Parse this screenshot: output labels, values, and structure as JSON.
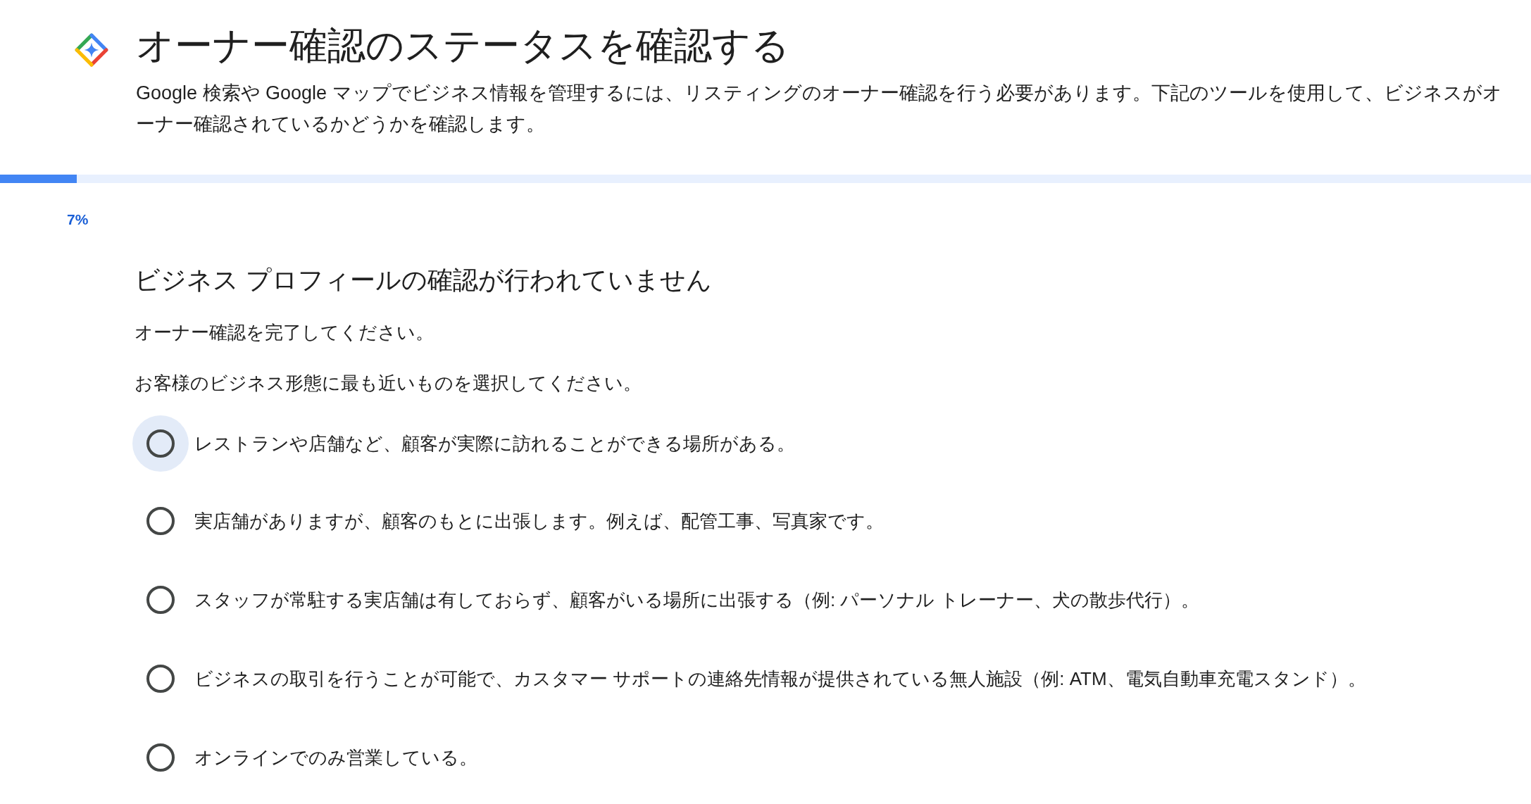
{
  "header": {
    "title": "オーナー確認のステータスを確認する",
    "description": "Google 検索や Google マップでビジネス情報を管理するには、リスティングのオーナー確認を行う必要があります。下記のツールを使用して、ビジネスがオーナー確認されているかどうかを確認します。"
  },
  "progress": {
    "level": 0.05,
    "reading": "7%"
  },
  "section": {
    "heading": "ビジネス プロフィールの確認が行われていません",
    "instruction": "オーナー確認を完了してください。",
    "question": "お客様のビジネス形態に最も近いものを選択してください。",
    "options": [
      {
        "label": "レストランや店舗など、顧客が実際に訪れることができる場所がある。",
        "selected": false,
        "highlighted": true
      },
      {
        "label": "実店舗がありますが、顧客のもとに出張します。例えば、配管工事、写真家です。",
        "selected": false,
        "highlighted": false
      },
      {
        "label": "スタッフが常駐する実店舗は有しておらず、顧客がいる場所に出張する（例: パーソナル トレーナー、犬の散歩代行）。",
        "selected": false,
        "highlighted": false
      },
      {
        "label": "ビジネスの取引を行うことが可能で、カスタマー サポートの連絡先情報が提供されている無人施設（例: ATM、電気自動車充電スタンド）。",
        "selected": false,
        "highlighted": false
      },
      {
        "label": "オンラインでのみ営業している。",
        "selected": false,
        "highlighted": false
      }
    ]
  }
}
